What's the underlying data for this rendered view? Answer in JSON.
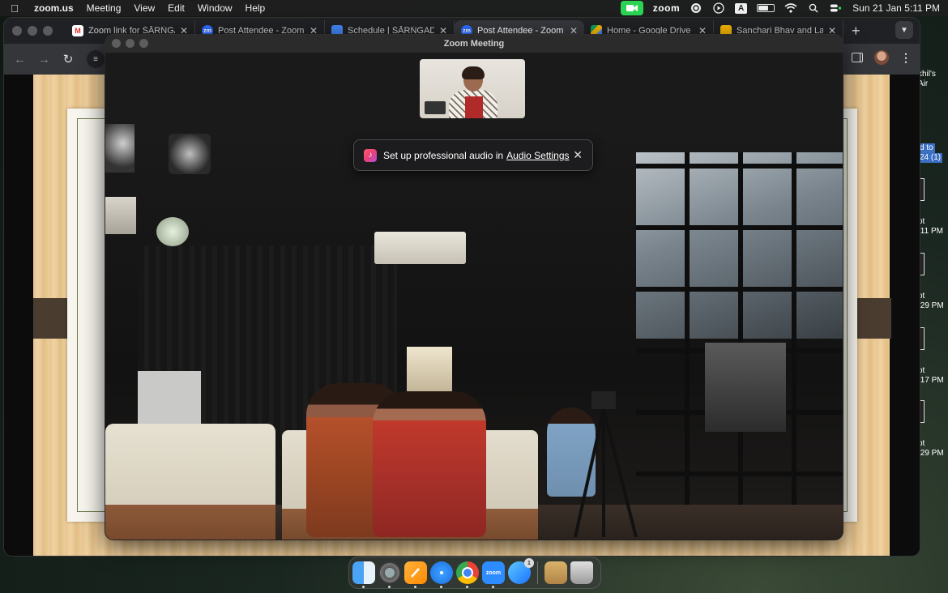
{
  "menubar": {
    "app_name": "zoom.us",
    "menus": [
      "Meeting",
      "View",
      "Edit",
      "Window",
      "Help"
    ],
    "status_zoom_label": "zoom",
    "keyboard_input": "A",
    "clock": "Sun 21 Jan  5:11 PM"
  },
  "browser": {
    "tabs": [
      {
        "label": "Zoom link for ŚĀRṄGA",
        "favicon": "gmail-icon",
        "active": false
      },
      {
        "label": "Post Attendee - Zoom",
        "favicon": "zoom-icon",
        "active": false
      },
      {
        "label": "Schedule | ŚĀRṄGADE",
        "favicon": "docs-icon",
        "active": false
      },
      {
        "label": "Post Attendee - Zoom",
        "favicon": "zoom-icon",
        "active": true
      },
      {
        "label": "Home - Google Drive",
        "favicon": "drive-icon",
        "active": false
      },
      {
        "label": "Sanchari Bhav and La",
        "favicon": "slides-icon",
        "active": false
      }
    ],
    "new_tab_glyph": "+"
  },
  "zoom": {
    "window_title": "Zoom Meeting",
    "audio_toast": {
      "text": "Set up professional audio in",
      "link": "Audio Settings"
    }
  },
  "desktop": {
    "labels": [
      "khil's",
      "Air",
      "d to",
      "24 (1)",
      "ot",
      ".11 PM",
      "ot",
      ".29 PM",
      "ot",
      ".17 PM",
      "ot",
      ".29 PM"
    ]
  },
  "dock": {
    "apps": [
      "Finder",
      "System Settings",
      "Pages",
      "Safari",
      "Chrome",
      "Zoom",
      "App Store",
      "Archive Utility",
      "Trash"
    ],
    "zoom_label": "zoom",
    "app_store_badge": "1"
  },
  "colors": {
    "zoom_green": "#2cd352",
    "zoom_blue": "#2d8cff",
    "toast_bg": "#1c1c1e"
  }
}
